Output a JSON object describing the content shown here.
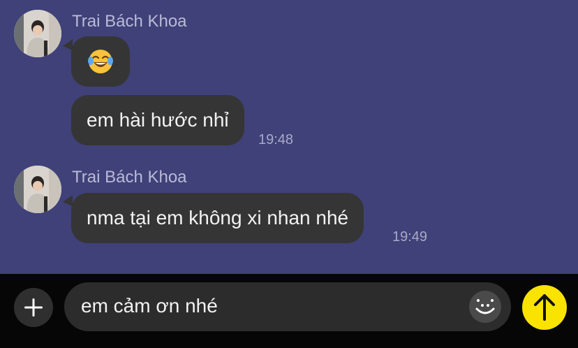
{
  "messages": [
    {
      "sender": "Trai Bách Khoa",
      "bubbles": [
        {
          "type": "emoji",
          "emoji": "face-with-tears-of-joy"
        },
        {
          "type": "text",
          "text": "em hài hước nhỉ",
          "time": "19:48"
        }
      ]
    },
    {
      "sender": "Trai Bách Khoa",
      "bubbles": [
        {
          "type": "text",
          "text": "nma tại em không xi nhan nhé",
          "time": "19:49"
        }
      ]
    }
  ],
  "composer": {
    "value": "em cảm ơn nhé",
    "plus_icon": "plus-icon",
    "emoji_icon": "smiley-icon",
    "send_icon": "arrow-up-icon"
  },
  "colors": {
    "chat_background": "#3f4178",
    "bubble": "#353535",
    "send_button": "#fbe300",
    "input_bar": "#060606"
  }
}
